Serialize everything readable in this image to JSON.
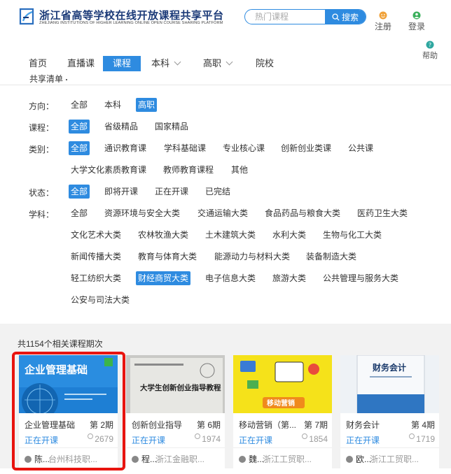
{
  "header": {
    "title": "浙江省高等学校在线开放课程共享平台",
    "subtitle": "ZHEJIANG INSTITUTIONS OF HIGHER LEARNING ONLINE OPEN COURSE SHARING PLATFORM",
    "search_placeholder": "热门课程",
    "search_button": "搜索",
    "register": "注册",
    "login": "登录",
    "help": "帮助"
  },
  "nav": {
    "items": [
      "首页",
      "直播课",
      "课程",
      "本科",
      "高职",
      "院校"
    ],
    "active": "课程",
    "share_list": "共享清单"
  },
  "filter": {
    "direction": {
      "label": "方向：",
      "options": [
        "全部",
        "本科",
        "高职"
      ],
      "selected": "高职"
    },
    "course": {
      "label": "课程：",
      "options": [
        "全部",
        "省级精品",
        "国家精品"
      ],
      "selected": "全部"
    },
    "category": {
      "label": "类别：",
      "options": [
        "全部",
        "通识教育课",
        "学科基础课",
        "专业核心课",
        "创新创业类课",
        "公共课",
        "大学文化素质教育课",
        "教师教育课程",
        "其他"
      ],
      "selected": "全部"
    },
    "status": {
      "label": "状态：",
      "options": [
        "全部",
        "即将开课",
        "正在开课",
        "已完结"
      ],
      "selected": "全部"
    },
    "subject": {
      "label": "学科：",
      "options": [
        "全部",
        "资源环境与安全大类",
        "交通运输大类",
        "食品药品与粮食大类",
        "医药卫生大类",
        "文化艺术大类",
        "农林牧渔大类",
        "土木建筑大类",
        "水利大类",
        "生物与化工大类",
        "新闻传播大类",
        "教育与体育大类",
        "能源动力与材料大类",
        "装备制造大类",
        "轻工纺织大类",
        "财经商贸大类",
        "电子信息大类",
        "旅游大类",
        "公共管理与服务大类",
        "公安与司法大类"
      ],
      "selected": "财经商贸大类"
    }
  },
  "results": {
    "count_text": "共1154个相关课程期次",
    "courses": [
      {
        "name": "企业管理基础",
        "period": "第 2期",
        "status": "正在开课",
        "learners": "2679",
        "teacher": "陈...",
        "school": "台州科技职...",
        "cover_text": "企业管理基础"
      },
      {
        "name": "创新创业指导",
        "period": "第 6期",
        "status": "正在开课",
        "learners": "1974",
        "teacher": "程...",
        "school": "浙江金融职...",
        "cover_text": "大学生创新创业指导教程"
      },
      {
        "name": "移动营销（第...",
        "period": "第 7期",
        "status": "正在开课",
        "learners": "1854",
        "teacher": "魏...",
        "school": "浙江工贸职...",
        "cover_text": "移动营销"
      },
      {
        "name": "财务会计",
        "period": "第 4期",
        "status": "正在开课",
        "learners": "1719",
        "teacher": "欧...",
        "school": "浙江工贸职...",
        "cover_text": "财务会计"
      }
    ]
  },
  "colors": {
    "accent": "#2e8be0",
    "highlight": "#e8140f"
  }
}
